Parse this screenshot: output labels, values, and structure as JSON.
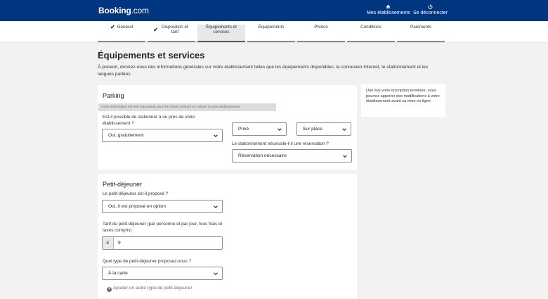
{
  "header": {
    "logo_main": "Booking",
    "logo_suffix": ".com",
    "properties_label": "Mes établissements",
    "logout_label": "Se déconnecter"
  },
  "steps": [
    {
      "label": "Général",
      "done": true
    },
    {
      "label": "Disposition et tarif",
      "done": true
    },
    {
      "label": "Équipements et services",
      "active": true
    },
    {
      "label": "Équipements"
    },
    {
      "label": "Photos"
    },
    {
      "label": "Conditions"
    },
    {
      "label": "Paiements"
    }
  ],
  "page": {
    "title": "Équipements et services",
    "intro": "À présent, donnez-nous des informations générales sur votre établissement telles que les équipements disponibles, la connexion Internet, le stationnement et les langues parlées."
  },
  "tip": {
    "text": "Une fois votre inscription terminée, vous pourrez apporter des modifications à votre établissement avant sa mise en ligne."
  },
  "parking": {
    "title": "Parking",
    "note": "Cette information est très importante pour les clients arrivant en voiture à votre établissement",
    "question": "Est-il possible de stationner à ou près de votre établissement ?",
    "availability_value": "Oui, gratuitement",
    "type_value": "Privé",
    "location_value": "Sur place",
    "reservation_question": "Le stationnement nécessite-t-il une réservation ?",
    "reservation_value": "Réservation nécessaire"
  },
  "breakfast": {
    "title": "Petit-déjeuner",
    "offered_question": "Le petit-déjeuner est-il proposé ?",
    "offered_value": "Oui, il est proposé en option",
    "price_question": "Tarif du petit-déjeuner (par personne et par jour, tous frais et taxes compris)",
    "currency_symbol": "€",
    "price_value": "9",
    "type_question": "Quel type de petit-déjeuner proposez-vous ?",
    "type_value": "À la carte",
    "add_type_label": "Ajouter un autre type de petit-déjeuner"
  }
}
